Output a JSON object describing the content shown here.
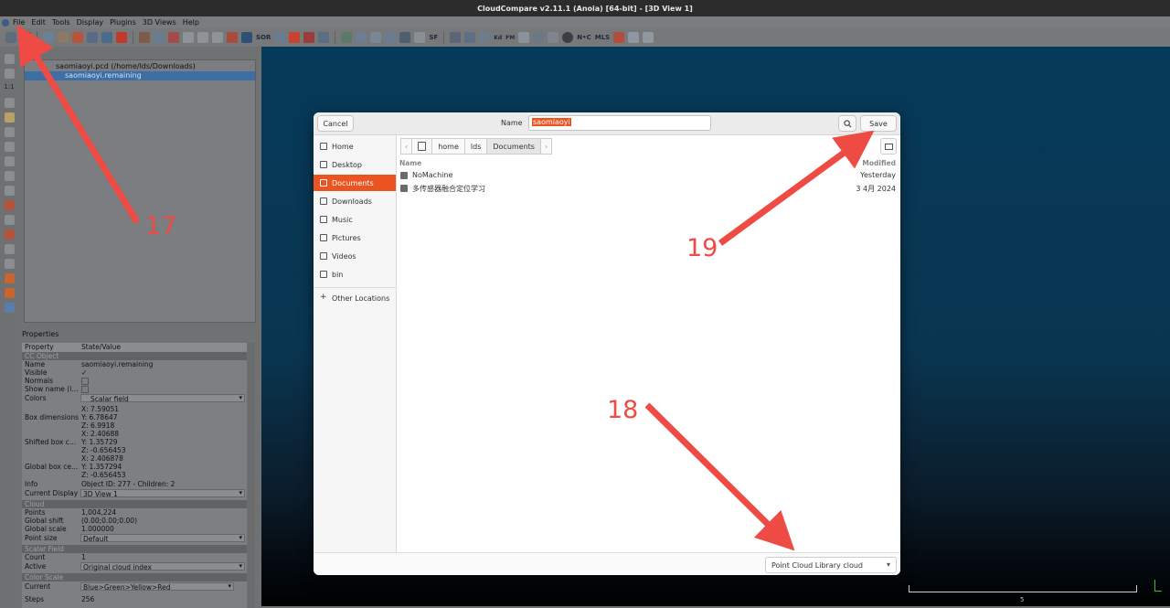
{
  "window": {
    "title": "CloudCompare v2.11.1 (Anoia) [64-bit] - [3D View 1]"
  },
  "menu": [
    "File",
    "Edit",
    "Tools",
    "Display",
    "Plugins",
    "3D Views",
    "Help"
  ],
  "toolbar": {
    "sor_label": "SOR",
    "sf_label": "SF",
    "kd_label": "Kd",
    "fm_label": "FM",
    "nc_label": "N•C",
    "mls_label": "MLS"
  },
  "db_tree": {
    "root_label": "saomiaoyi.pcd (/home/lds/Downloads)",
    "child_label": "saomiaoyi.remaining"
  },
  "properties": {
    "title": "Properties",
    "header": {
      "property": "Property",
      "value": "State/Value"
    },
    "sections": {
      "cc_object": "CC Object",
      "cloud": "Cloud",
      "scalar_field": "Scalar Field",
      "color_scale": "Color Scale"
    },
    "rows": {
      "name": {
        "k": "Name",
        "v": "saomiaoyi.remaining"
      },
      "visible": {
        "k": "Visible",
        "v": "✓"
      },
      "normals": {
        "k": "Normals",
        "v": ""
      },
      "show_name": {
        "k": "Show name (i...",
        "v": ""
      },
      "colors": {
        "k": "Colors",
        "v": "Scalar field"
      },
      "box_dim": {
        "k": "Box dimensions",
        "v": "X: 7.59051\nY: 6.78647\nZ: 6.9918"
      },
      "shifted_box": {
        "k": "Shifted box c...",
        "v": "X: 2.40688\nY: 1.35729\nZ: -0.656453"
      },
      "global_box": {
        "k": "Global box ce...",
        "v": "X: 2.406878\nY: 1.357294\nZ: -0.656453"
      },
      "info": {
        "k": "Info",
        "v": "Object ID: 277 - Children: 2"
      },
      "current_display": {
        "k": "Current Display",
        "v": "3D View 1"
      },
      "points": {
        "k": "Points",
        "v": "1,004,224"
      },
      "global_shift": {
        "k": "Global shift",
        "v": "(0.00;0.00;0.00)"
      },
      "global_scale": {
        "k": "Global scale",
        "v": "1.000000"
      },
      "point_size": {
        "k": "Point size",
        "v": "Default"
      },
      "count": {
        "k": "Count",
        "v": "1"
      },
      "active": {
        "k": "Active",
        "v": "Original cloud index"
      },
      "current": {
        "k": "Current",
        "v": "Blue>Green>Yellow>Red"
      },
      "steps": {
        "k": "Steps",
        "v": "256"
      }
    }
  },
  "view": {
    "scale_label": "5"
  },
  "dialog": {
    "cancel_label": "Cancel",
    "name_label": "Name",
    "name_value": "saomiaoyi",
    "save_label": "Save",
    "sidebar": [
      "Home",
      "Desktop",
      "Documents",
      "Downloads",
      "Music",
      "Pictures",
      "Videos",
      "bin",
      "Other Locations"
    ],
    "path": [
      "home",
      "lds",
      "Documents"
    ],
    "columns": {
      "name": "Name",
      "modified": "Modified"
    },
    "files": [
      {
        "name": "NoMachine",
        "modified": "Yesterday"
      },
      {
        "name": "多传感器融合定位学习",
        "modified": "3 4月 2024"
      }
    ],
    "filter": "Point Cloud Library cloud"
  },
  "annotations": [
    "17",
    "18",
    "19"
  ],
  "colors": {
    "accent": "#e95420",
    "arrow": "#ee4b44",
    "selection": "#3d6fa5"
  }
}
